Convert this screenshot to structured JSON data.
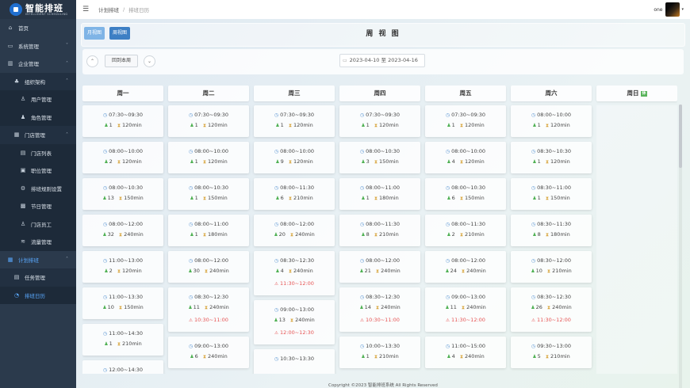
{
  "app": {
    "logo_title": "智能排班",
    "logo_sub": "INTELLIGENT SCHEDULING"
  },
  "sidebar": {
    "items": [
      {
        "label": "首页",
        "icon": "home-icon",
        "level": "group",
        "state": ""
      },
      {
        "label": "系统管理",
        "icon": "monitor-icon",
        "level": "group",
        "state": "",
        "arrow": "˅"
      },
      {
        "label": "企业管理",
        "icon": "building-icon",
        "level": "group",
        "state": "",
        "arrow": "˄"
      },
      {
        "label": "组织架构",
        "icon": "org-icon",
        "level": "sub",
        "state": "",
        "arrow": "˄"
      },
      {
        "label": "用户管理",
        "icon": "user-icon",
        "level": "subsub",
        "state": ""
      },
      {
        "label": "角色管理",
        "icon": "role-icon",
        "level": "subsub",
        "state": ""
      },
      {
        "label": "门店管理",
        "icon": "store-icon",
        "level": "sub",
        "state": "",
        "arrow": "˄"
      },
      {
        "label": "门店列表",
        "icon": "list-icon",
        "level": "subsub",
        "state": ""
      },
      {
        "label": "职位管理",
        "icon": "position-icon",
        "level": "subsub",
        "state": ""
      },
      {
        "label": "排班规则设置",
        "icon": "rules-icon",
        "level": "subsub",
        "state": ""
      },
      {
        "label": "节日管理",
        "icon": "holiday-icon",
        "level": "subsub",
        "state": ""
      },
      {
        "label": "门店员工",
        "icon": "staff-icon",
        "level": "subsub",
        "state": ""
      },
      {
        "label": "流量管理",
        "icon": "traffic-icon",
        "level": "subsub",
        "state": ""
      },
      {
        "label": "计划排班",
        "icon": "calendar-icon",
        "level": "group",
        "state": "active-group",
        "arrow": "˄"
      },
      {
        "label": "任务管理",
        "icon": "task-icon",
        "level": "sub",
        "state": ""
      },
      {
        "label": "排班日历",
        "icon": "schedule-icon",
        "level": "sub",
        "state": "active"
      }
    ]
  },
  "topbar": {
    "breadcrumb_1": "计划排班",
    "breadcrumb_sep": "/",
    "breadcrumb_2": "排班日历",
    "user_name": "one"
  },
  "view": {
    "month_button": "月视图",
    "week_button": "周视图",
    "title": "周 视 图",
    "back_today": "回到本周",
    "date_range": "2023-04-10 至 2023-04-16"
  },
  "week": {
    "rest_label": "休",
    "days": [
      {
        "name": "周一",
        "shifts": [
          {
            "time": "07:30~09:30",
            "people": "1",
            "duration": "120min",
            "break": ""
          },
          {
            "time": "08:00~10:00",
            "people": "2",
            "duration": "120min",
            "break": ""
          },
          {
            "time": "08:00~10:30",
            "people": "13",
            "duration": "150min",
            "break": ""
          },
          {
            "time": "08:00~12:00",
            "people": "32",
            "duration": "240min",
            "break": ""
          },
          {
            "time": "11:00~13:00",
            "people": "2",
            "duration": "120min",
            "break": ""
          },
          {
            "time": "11:00~13:30",
            "people": "10",
            "duration": "150min",
            "break": ""
          },
          {
            "time": "11:00~14:30",
            "people": "1",
            "duration": "210min",
            "break": ""
          },
          {
            "time": "12:00~14:30",
            "people": "",
            "duration": "",
            "break": ""
          }
        ]
      },
      {
        "name": "周二",
        "shifts": [
          {
            "time": "07:30~09:30",
            "people": "1",
            "duration": "120min",
            "break": ""
          },
          {
            "time": "08:00~10:00",
            "people": "1",
            "duration": "120min",
            "break": ""
          },
          {
            "time": "08:00~10:30",
            "people": "1",
            "duration": "150min",
            "break": ""
          },
          {
            "time": "08:00~11:00",
            "people": "1",
            "duration": "180min",
            "break": ""
          },
          {
            "time": "08:00~12:00",
            "people": "30",
            "duration": "240min",
            "break": ""
          },
          {
            "time": "08:30~12:30",
            "people": "11",
            "duration": "240min",
            "break": "10:30~11:00"
          },
          {
            "time": "09:00~13:00",
            "people": "6",
            "duration": "240min",
            "break": ""
          }
        ]
      },
      {
        "name": "周三",
        "shifts": [
          {
            "time": "07:30~09:30",
            "people": "1",
            "duration": "120min",
            "break": ""
          },
          {
            "time": "08:00~10:00",
            "people": "9",
            "duration": "120min",
            "break": ""
          },
          {
            "time": "08:00~11:30",
            "people": "6",
            "duration": "210min",
            "break": ""
          },
          {
            "time": "08:00~12:00",
            "people": "20",
            "duration": "240min",
            "break": ""
          },
          {
            "time": "08:30~12:30",
            "people": "4",
            "duration": "240min",
            "break": "11:30~12:00"
          },
          {
            "time": "09:00~13:00",
            "people": "13",
            "duration": "240min",
            "break": "12:00~12:30"
          },
          {
            "time": "10:30~13:30",
            "people": "",
            "duration": "",
            "break": ""
          }
        ]
      },
      {
        "name": "周四",
        "shifts": [
          {
            "time": "07:30~09:30",
            "people": "1",
            "duration": "120min",
            "break": ""
          },
          {
            "time": "08:00~10:30",
            "people": "3",
            "duration": "150min",
            "break": ""
          },
          {
            "time": "08:00~11:00",
            "people": "1",
            "duration": "180min",
            "break": ""
          },
          {
            "time": "08:00~11:30",
            "people": "8",
            "duration": "210min",
            "break": ""
          },
          {
            "time": "08:00~12:00",
            "people": "21",
            "duration": "240min",
            "break": ""
          },
          {
            "time": "08:30~12:30",
            "people": "14",
            "duration": "240min",
            "break": "10:30~11:00"
          },
          {
            "time": "10:00~13:30",
            "people": "1",
            "duration": "210min",
            "break": ""
          }
        ]
      },
      {
        "name": "周五",
        "shifts": [
          {
            "time": "07:30~09:30",
            "people": "1",
            "duration": "120min",
            "break": ""
          },
          {
            "time": "08:00~10:00",
            "people": "4",
            "duration": "120min",
            "break": ""
          },
          {
            "time": "08:00~10:30",
            "people": "6",
            "duration": "150min",
            "break": ""
          },
          {
            "time": "08:00~11:30",
            "people": "2",
            "duration": "210min",
            "break": ""
          },
          {
            "time": "08:00~12:00",
            "people": "24",
            "duration": "240min",
            "break": ""
          },
          {
            "time": "09:00~13:00",
            "people": "11",
            "duration": "240min",
            "break": "11:30~12:00"
          },
          {
            "time": "11:00~15:00",
            "people": "4",
            "duration": "240min",
            "break": ""
          }
        ]
      },
      {
        "name": "周六",
        "shifts": [
          {
            "time": "08:00~10:00",
            "people": "1",
            "duration": "120min",
            "break": ""
          },
          {
            "time": "08:30~10:30",
            "people": "1",
            "duration": "120min",
            "break": ""
          },
          {
            "time": "08:30~11:00",
            "people": "1",
            "duration": "150min",
            "break": ""
          },
          {
            "time": "08:30~11:30",
            "people": "8",
            "duration": "180min",
            "break": ""
          },
          {
            "time": "08:30~12:00",
            "people": "10",
            "duration": "210min",
            "break": ""
          },
          {
            "time": "08:30~12:30",
            "people": "26",
            "duration": "240min",
            "break": "11:30~12:00"
          },
          {
            "time": "09:30~13:00",
            "people": "5",
            "duration": "210min",
            "break": ""
          }
        ]
      },
      {
        "name": "周日",
        "rest": true,
        "shifts": []
      }
    ]
  },
  "footer": {
    "text": "Copyright ©2023 智能排班系统 All Rights Reserved"
  },
  "colors": {
    "sidebar_bg": "#2b3a4c",
    "accent": "#3d7fc4",
    "break_red": "#e65353",
    "people_green": "#4caf50",
    "hourglass": "#d7a43a"
  }
}
